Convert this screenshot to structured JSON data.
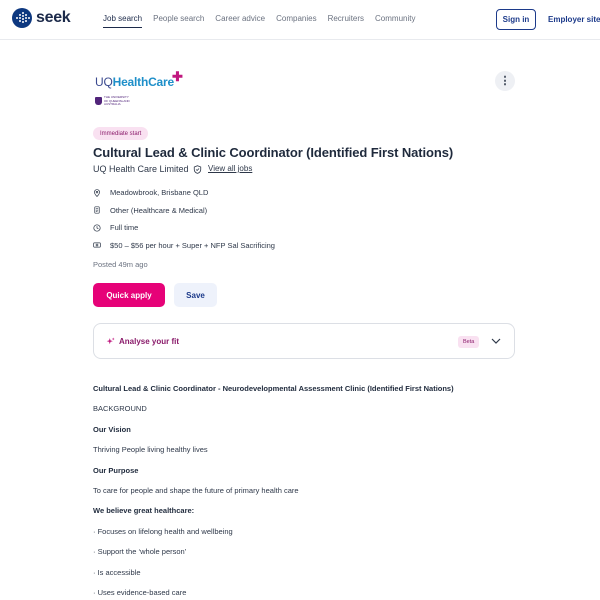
{
  "header": {
    "logo_text": "seek",
    "nav": [
      "Job search",
      "People search",
      "Career advice",
      "Companies",
      "Recruiters",
      "Community"
    ],
    "sign_in": "Sign in",
    "employer_site": "Employer site"
  },
  "company": {
    "logo_uq": "UQ",
    "logo_hc": "HealthCare",
    "uni_name": "THE UNIVERSITY OF QUEENSLAND AUSTRALIA"
  },
  "job": {
    "badge": "Immediate start",
    "title": "Cultural Lead & Clinic Coordinator (Identified First Nations)",
    "advertiser": "UQ Health Care Limited",
    "view_all_jobs": "View all jobs",
    "location": "Meadowbrook, Brisbane QLD",
    "classification": "Other (Healthcare & Medical)",
    "work_type": "Full time",
    "salary": "$50 – $56 per hour + Super + NFP Sal Sacrificing",
    "posted": "Posted 49m ago"
  },
  "actions": {
    "quick_apply": "Quick apply",
    "save": "Save"
  },
  "fit": {
    "label": "Analyse your fit",
    "badge": "Beta"
  },
  "description": [
    {
      "text": "Cultural Lead & Clinic Coordinator - Neurodevelopmental Assessment Clinic (Identified First Nations)",
      "bold": true
    },
    {
      "text": "BACKGROUND",
      "bold": false
    },
    {
      "text": "Our Vision",
      "bold": true
    },
    {
      "text": "Thriving People living healthy lives",
      "bold": false
    },
    {
      "text": "Our Purpose",
      "bold": true
    },
    {
      "text": "To care for people and shape the future of primary health care",
      "bold": false
    },
    {
      "text": "We believe great healthcare:",
      "bold": true
    },
    {
      "text": "· Focuses on lifelong health and wellbeing",
      "bold": false
    },
    {
      "text": "· Support the ‘whole person’",
      "bold": false
    },
    {
      "text": "· Is accessible",
      "bold": false
    },
    {
      "text": "· Uses evidence-based care",
      "bold": false
    }
  ],
  "colors": {
    "brand_navy": "#0d3880",
    "apply_pink": "#e60278",
    "badge_bg": "#f9e1f1"
  }
}
